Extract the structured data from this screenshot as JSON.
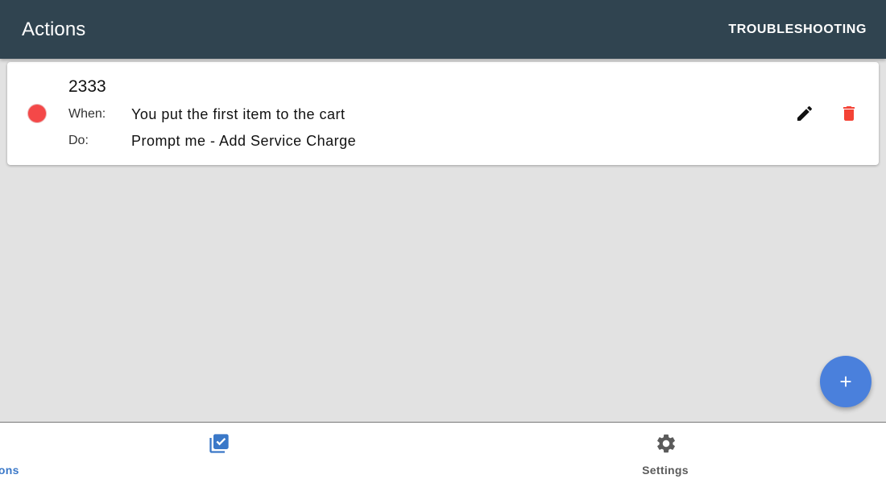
{
  "topbar": {
    "title": "Actions",
    "troubleshooting_label": "TROUBLESHOOTING"
  },
  "colors": {
    "topbar_bg": "#304450",
    "status_dot": "#f44848",
    "delete_icon": "#f44336",
    "fab_bg": "#4a80dc",
    "active_nav": "#3a78c8",
    "inactive_nav": "#5b5b5b"
  },
  "actions_list": [
    {
      "name": "2333",
      "status_icon": "record-dot-icon",
      "when_label": "When:",
      "when_value": "You put the first item to the cart",
      "do_label": "Do:",
      "do_value": "Prompt me - Add Service Charge",
      "edit_icon": "pencil-icon",
      "delete_icon": "trash-icon"
    }
  ],
  "fab": {
    "icon": "plus-icon"
  },
  "bottom_nav": {
    "items": [
      {
        "label": "Actions",
        "icon": "checklist-icon",
        "active": true
      },
      {
        "label": "Settings",
        "icon": "gear-icon",
        "active": false
      }
    ]
  }
}
